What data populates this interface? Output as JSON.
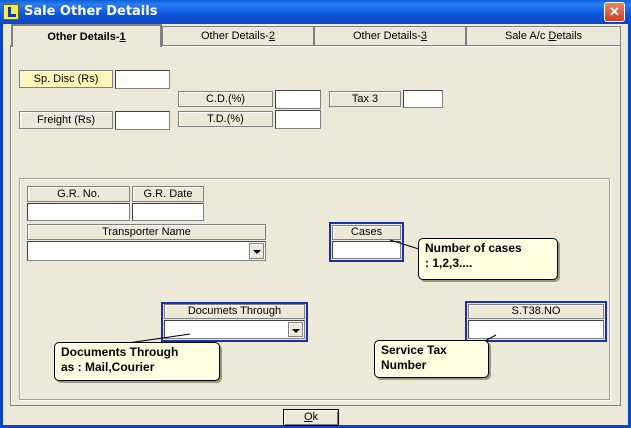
{
  "window": {
    "title": "Sale Other Details",
    "close_glyph": "✕"
  },
  "tabs": [
    {
      "label": "Other Details-",
      "key": "1",
      "active": true
    },
    {
      "label": "Other Details-",
      "key": "2",
      "active": false
    },
    {
      "label": "Other Details-",
      "key": "3",
      "active": false
    },
    {
      "label": "Sale A/c ",
      "key": "D",
      "rest": "etails",
      "active": false
    }
  ],
  "top_fields": {
    "sp_disc_label": "Sp. Disc (Rs)",
    "sp_disc_value": "",
    "freight_label": "Freight (Rs)",
    "freight_value": "",
    "cd_label": "C.D.(%)",
    "cd_value": "",
    "td_label": "T.D.(%)",
    "td_value": "",
    "tax3_label": "Tax 3",
    "tax3_value": ""
  },
  "transport": {
    "gr_no_label": "G.R. No.",
    "gr_no_value": "",
    "gr_date_label": "G.R. Date",
    "gr_date_value": "",
    "transporter_label": "Transporter Name",
    "transporter_value": "",
    "cases_label": "Cases",
    "cases_value": "",
    "documents_label": "Documets Through",
    "documents_value": "",
    "st38_label": "S.T38.NO",
    "st38_value": ""
  },
  "callouts": {
    "cases_line1": "Number of cases",
    "cases_line2": ": 1,2,3....",
    "documents_line1": "Documents Through",
    "documents_line2": "as : Mail,Courier",
    "st38_line1": "Service Tax",
    "st38_line2": "Number"
  },
  "footer": {
    "ok_key": "O",
    "ok_rest": "k"
  },
  "colors": {
    "titlebar": "#0b55d9",
    "highlight_border": "#1a2fb0",
    "yellow_label": "#fff8b8",
    "tooltip_bg": "#ffffe1",
    "dialog_bg": "#ece9d8"
  }
}
